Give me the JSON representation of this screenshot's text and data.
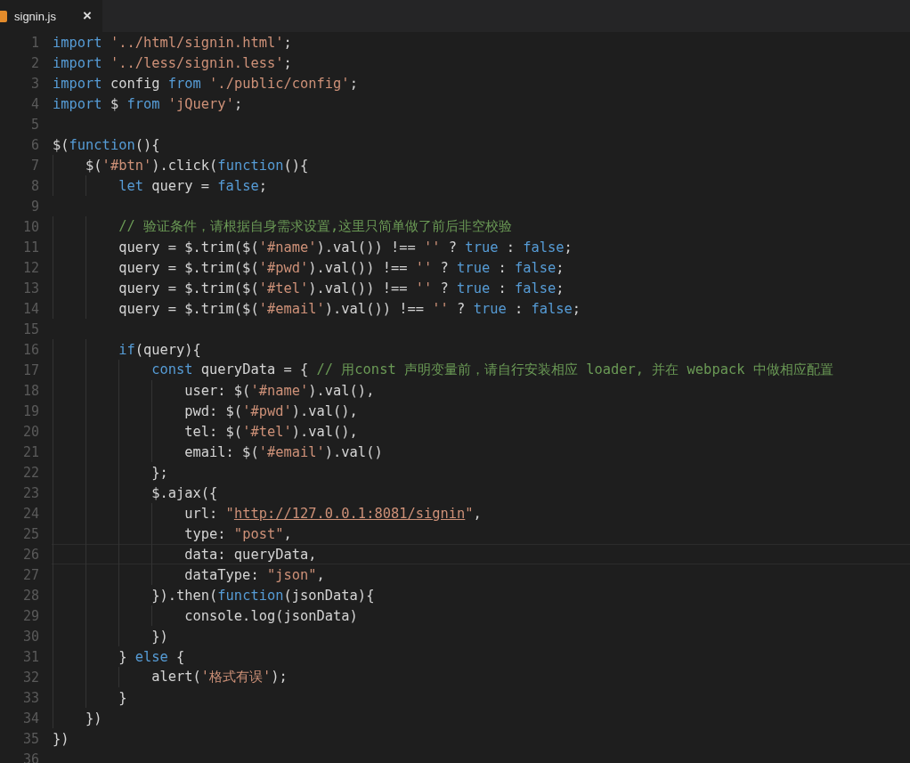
{
  "tabs": [
    {
      "label": "signin.js",
      "close": "×",
      "selected": true
    }
  ],
  "lines": [
    {
      "number": "1",
      "current": false,
      "tokens": [
        {
          "kind": "keyword",
          "text": "import"
        },
        {
          "kind": "string",
          "text": " '../html/signin.html'"
        },
        {
          "kind": "plain",
          "text": ";"
        }
      ]
    },
    {
      "number": "2",
      "current": false,
      "tokens": [
        {
          "kind": "keyword",
          "text": "import"
        },
        {
          "kind": "string",
          "text": " '../less/signin.less'"
        },
        {
          "kind": "plain",
          "text": ";"
        }
      ]
    },
    {
      "number": "3",
      "current": false,
      "tokens": [
        {
          "kind": "keyword",
          "text": "import"
        },
        {
          "kind": "plain",
          "text": " config "
        },
        {
          "kind": "keyword",
          "text": "from"
        },
        {
          "kind": "string",
          "text": " './public/config'"
        },
        {
          "kind": "plain",
          "text": ";"
        }
      ]
    },
    {
      "number": "4",
      "current": false,
      "tokens": [
        {
          "kind": "keyword",
          "text": "import"
        },
        {
          "kind": "plain",
          "text": " $ "
        },
        {
          "kind": "keyword",
          "text": "from"
        },
        {
          "kind": "string",
          "text": " 'jQuery'"
        },
        {
          "kind": "plain",
          "text": ";"
        }
      ]
    },
    {
      "number": "5",
      "current": false
    },
    {
      "number": "6",
      "current": false,
      "tokens": [
        {
          "kind": "plain",
          "text": "$("
        },
        {
          "kind": "keyword",
          "text": "function"
        },
        {
          "kind": "plain",
          "text": "(){"
        }
      ]
    },
    {
      "number": "7",
      "current": false,
      "tokens": [
        {
          "kind": "plain",
          "text": "    $("
        },
        {
          "kind": "string",
          "text": "'#btn'"
        },
        {
          "kind": "plain",
          "text": ").click("
        },
        {
          "kind": "keyword",
          "text": "function"
        },
        {
          "kind": "plain",
          "text": "(){"
        }
      ]
    },
    {
      "number": "8",
      "current": false,
      "tokens": [
        {
          "kind": "keyword",
          "text": "        let"
        },
        {
          "kind": "plain",
          "text": " query = "
        },
        {
          "kind": "keyword",
          "text": "false"
        },
        {
          "kind": "plain",
          "text": ";"
        }
      ]
    },
    {
      "number": "9",
      "current": false
    },
    {
      "number": "10",
      "current": false,
      "tokens": [
        {
          "kind": "comment",
          "text": "        // 验证条件，请根据自身需求设置,这里只简单做了前后非空校验"
        }
      ]
    },
    {
      "number": "11",
      "current": false,
      "tokens": [
        {
          "kind": "plain",
          "text": "        query = $.trim($("
        },
        {
          "kind": "string",
          "text": "'#name'"
        },
        {
          "kind": "plain",
          "text": ").val()) !== "
        },
        {
          "kind": "string",
          "text": "''"
        },
        {
          "kind": "plain",
          "text": " ? "
        },
        {
          "kind": "keyword",
          "text": "true"
        },
        {
          "kind": "plain",
          "text": " : "
        },
        {
          "kind": "keyword",
          "text": "false"
        },
        {
          "kind": "plain",
          "text": ";"
        }
      ]
    },
    {
      "number": "12",
      "current": false,
      "tokens": [
        {
          "kind": "plain",
          "text": "        query = $.trim($("
        },
        {
          "kind": "string",
          "text": "'#pwd'"
        },
        {
          "kind": "plain",
          "text": ").val()) !== "
        },
        {
          "kind": "string",
          "text": "''"
        },
        {
          "kind": "plain",
          "text": " ? "
        },
        {
          "kind": "keyword",
          "text": "true"
        },
        {
          "kind": "plain",
          "text": " : "
        },
        {
          "kind": "keyword",
          "text": "false"
        },
        {
          "kind": "plain",
          "text": ";"
        }
      ]
    },
    {
      "number": "13",
      "current": false,
      "tokens": [
        {
          "kind": "plain",
          "text": "        query = $.trim($("
        },
        {
          "kind": "string",
          "text": "'#tel'"
        },
        {
          "kind": "plain",
          "text": ").val()) !== "
        },
        {
          "kind": "string",
          "text": "''"
        },
        {
          "kind": "plain",
          "text": " ? "
        },
        {
          "kind": "keyword",
          "text": "true"
        },
        {
          "kind": "plain",
          "text": " : "
        },
        {
          "kind": "keyword",
          "text": "false"
        },
        {
          "kind": "plain",
          "text": ";"
        }
      ]
    },
    {
      "number": "14",
      "current": false,
      "tokens": [
        {
          "kind": "plain",
          "text": "        query = $.trim($("
        },
        {
          "kind": "string",
          "text": "'#email'"
        },
        {
          "kind": "plain",
          "text": ").val()) !== "
        },
        {
          "kind": "string",
          "text": "''"
        },
        {
          "kind": "plain",
          "text": " ? "
        },
        {
          "kind": "keyword",
          "text": "true"
        },
        {
          "kind": "plain",
          "text": " : "
        },
        {
          "kind": "keyword",
          "text": "false"
        },
        {
          "kind": "plain",
          "text": ";"
        }
      ]
    },
    {
      "number": "15",
      "current": false
    },
    {
      "number": "16",
      "current": false,
      "tokens": [
        {
          "kind": "keyword",
          "text": "        if"
        },
        {
          "kind": "plain",
          "text": "(query){"
        }
      ]
    },
    {
      "number": "17",
      "current": false,
      "tokens": [
        {
          "kind": "keyword",
          "text": "            const"
        },
        {
          "kind": "plain",
          "text": " queryData = { "
        },
        {
          "kind": "comment",
          "text": "// 用const 声明变量前，请自行安装相应 loader, 并在 webpack 中做相应配置"
        }
      ]
    },
    {
      "number": "18",
      "current": false,
      "tokens": [
        {
          "kind": "plain",
          "text": "                user: $("
        },
        {
          "kind": "string",
          "text": "'#name'"
        },
        {
          "kind": "plain",
          "text": ").val(),"
        }
      ]
    },
    {
      "number": "19",
      "current": false,
      "tokens": [
        {
          "kind": "plain",
          "text": "                pwd: $("
        },
        {
          "kind": "string",
          "text": "'#pwd'"
        },
        {
          "kind": "plain",
          "text": ").val(),"
        }
      ]
    },
    {
      "number": "20",
      "current": false,
      "tokens": [
        {
          "kind": "plain",
          "text": "                tel: $("
        },
        {
          "kind": "string",
          "text": "'#tel'"
        },
        {
          "kind": "plain",
          "text": ").val(),"
        }
      ]
    },
    {
      "number": "21",
      "current": false,
      "tokens": [
        {
          "kind": "plain",
          "text": "                email: $("
        },
        {
          "kind": "string",
          "text": "'#email'"
        },
        {
          "kind": "plain",
          "text": ").val()"
        }
      ]
    },
    {
      "number": "22",
      "current": false,
      "tokens": [
        {
          "kind": "plain",
          "text": "            };"
        }
      ]
    },
    {
      "number": "23",
      "current": false,
      "tokens": [
        {
          "kind": "plain",
          "text": "            $.ajax({"
        }
      ]
    },
    {
      "number": "24",
      "current": false,
      "tokens": [
        {
          "kind": "plain",
          "text": "                url: "
        },
        {
          "kind": "string",
          "text": "\""
        },
        {
          "kind": "url",
          "text": "http://127.0.0.1:8081/signin"
        },
        {
          "kind": "string",
          "text": "\""
        },
        {
          "kind": "plain",
          "text": ","
        }
      ]
    },
    {
      "number": "25",
      "current": false,
      "tokens": [
        {
          "kind": "plain",
          "text": "                type: "
        },
        {
          "kind": "string",
          "text": "\"post\""
        },
        {
          "kind": "plain",
          "text": ","
        }
      ]
    },
    {
      "number": "26",
      "current": true,
      "tokens": [
        {
          "kind": "plain",
          "text": "                data: queryData,"
        }
      ]
    },
    {
      "number": "27",
      "current": false,
      "tokens": [
        {
          "kind": "plain",
          "text": "                dataType: "
        },
        {
          "kind": "string",
          "text": "\"json\""
        },
        {
          "kind": "plain",
          "text": ","
        }
      ]
    },
    {
      "number": "28",
      "current": false,
      "tokens": [
        {
          "kind": "plain",
          "text": "            }).then("
        },
        {
          "kind": "keyword",
          "text": "function"
        },
        {
          "kind": "plain",
          "text": "(jsonData){"
        }
      ]
    },
    {
      "number": "29",
      "current": false,
      "tokens": [
        {
          "kind": "plain",
          "text": "                console.log(jsonData)"
        }
      ]
    },
    {
      "number": "30",
      "current": false,
      "tokens": [
        {
          "kind": "plain",
          "text": "            })"
        }
      ]
    },
    {
      "number": "31",
      "current": false,
      "tokens": [
        {
          "kind": "plain",
          "text": "        } "
        },
        {
          "kind": "keyword",
          "text": "else"
        },
        {
          "kind": "plain",
          "text": " {"
        }
      ]
    },
    {
      "number": "32",
      "current": false,
      "tokens": [
        {
          "kind": "plain",
          "text": "            alert("
        },
        {
          "kind": "string",
          "text": "'格式有误'"
        },
        {
          "kind": "plain",
          "text": ");"
        }
      ]
    },
    {
      "number": "33",
      "current": false,
      "tokens": [
        {
          "kind": "plain",
          "text": "        }"
        }
      ]
    },
    {
      "number": "34",
      "current": false,
      "tokens": [
        {
          "kind": "plain",
          "text": "    })"
        }
      ]
    },
    {
      "number": "35",
      "current": false,
      "tokens": [
        {
          "kind": "plain",
          "text": "})"
        }
      ]
    },
    {
      "number": "36",
      "current": false
    }
  ]
}
